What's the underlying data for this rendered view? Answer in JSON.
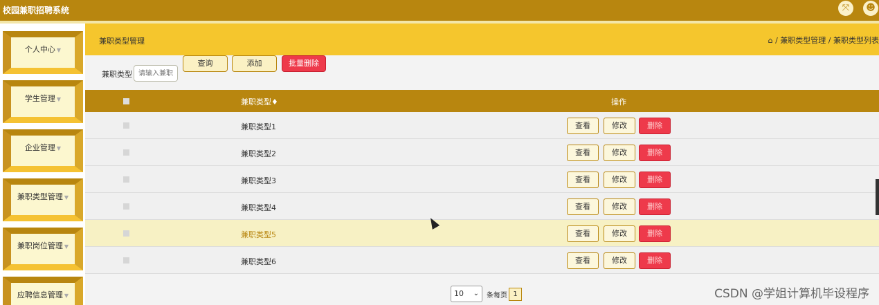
{
  "app": {
    "title": "校园兼职招聘系统"
  },
  "topbar": {
    "icons": [
      "fullscreen-icon",
      "user-icon"
    ],
    "accent": "#b8860f"
  },
  "sidebar": {
    "items": [
      {
        "label": "个人中心"
      },
      {
        "label": "学生管理"
      },
      {
        "label": "企业管理"
      },
      {
        "label": "兼职类型管理"
      },
      {
        "label": "兼职岗位管理"
      },
      {
        "label": "应聘信息管理"
      }
    ]
  },
  "header": {
    "title": "兼职类型管理",
    "breadcrumb": [
      "兼职类型管理",
      "兼职类型列表"
    ]
  },
  "search": {
    "label": "兼职类型",
    "placeholder": "请输入兼职",
    "query_label": "查询",
    "add_label": "添加",
    "batch_delete_label": "批量删除"
  },
  "table": {
    "columns": [
      "兼职类型",
      "操作"
    ],
    "sort_glyph": "♦",
    "rows": [
      {
        "name": "兼职类型1"
      },
      {
        "name": "兼职类型2"
      },
      {
        "name": "兼职类型3"
      },
      {
        "name": "兼职类型4"
      },
      {
        "name": "兼职类型5"
      },
      {
        "name": "兼职类型6"
      }
    ],
    "actions": {
      "view": "查看",
      "edit": "修改",
      "delete": "删除"
    }
  },
  "pagination": {
    "page_size": "10",
    "per_page_label": "条每页",
    "current_page": "1"
  },
  "watermark": "CSDN @学姐计算机毕设程序",
  "colors": {
    "primary": "#b8860f",
    "header": "#f5c62d",
    "danger": "#ee3a4b",
    "highlight_row": "#f7f1c4"
  }
}
